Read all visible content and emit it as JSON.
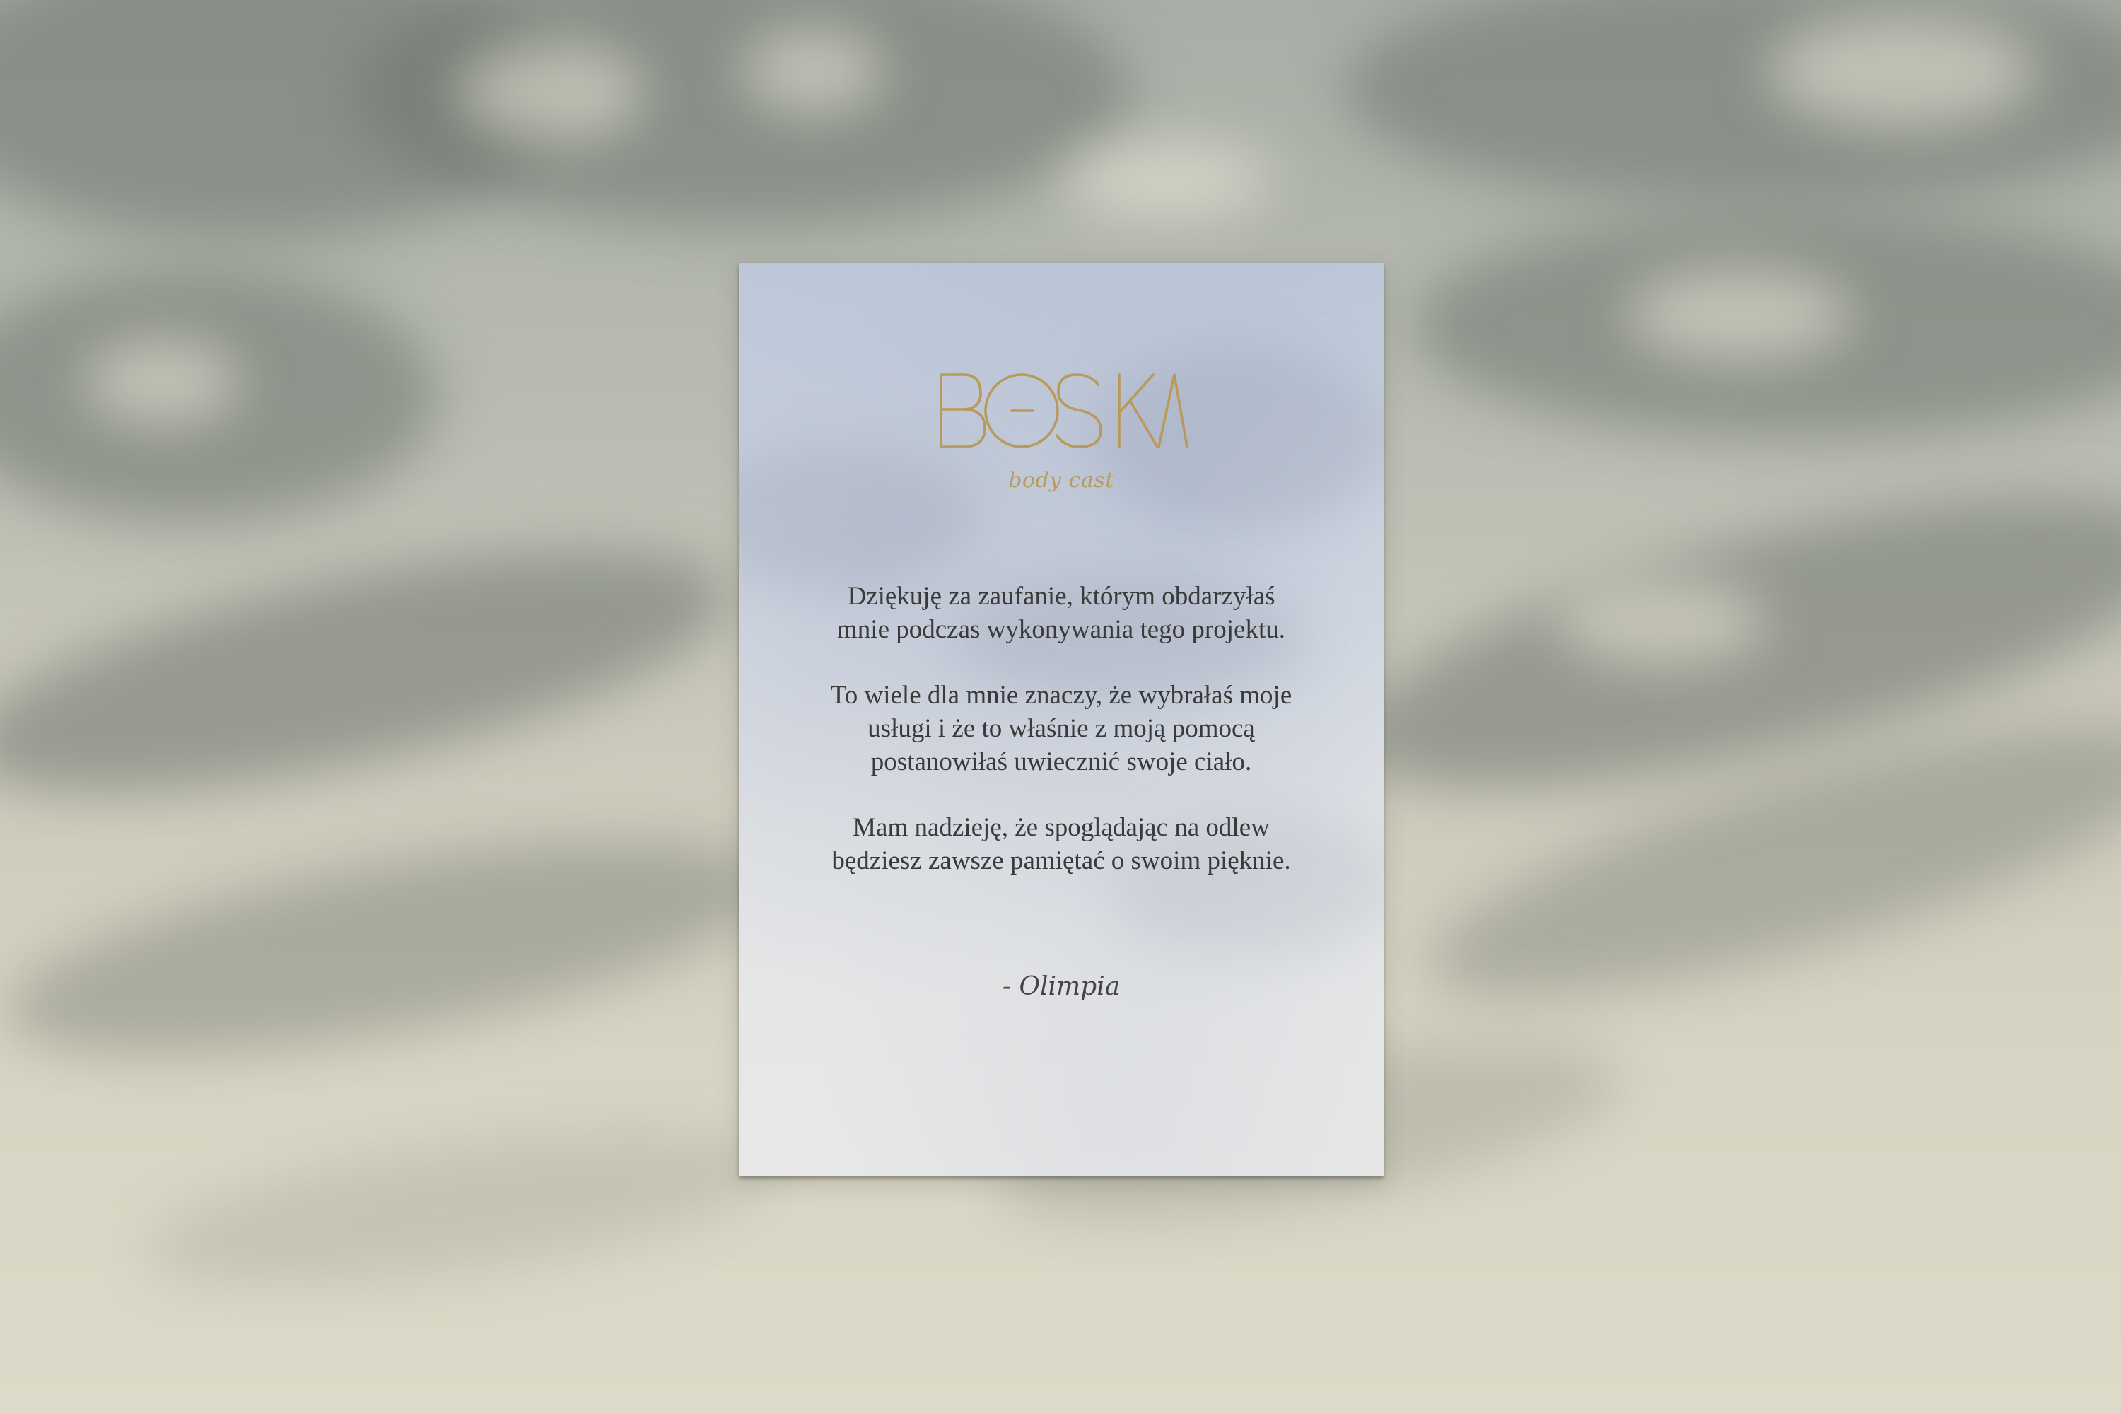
{
  "brand": {
    "name": "BOSKA",
    "tagline": "body cast",
    "color": "#b99a5c"
  },
  "message": {
    "paragraph1": {
      "line1": "Dziękuję za zaufanie, którym obdarzyłaś",
      "line2": "mnie podczas wykonywania tego projektu."
    },
    "paragraph2": {
      "line1": "To wiele dla mnie znaczy, że wybrałaś moje",
      "line2": "usługi i że to właśnie z moją pomocą",
      "line3": "postanowiłaś uwiecznić swoje ciało."
    },
    "paragraph3": {
      "line1": "Mam nadzieję, że spoglądając na odlew",
      "line2": "będziesz zawsze pamiętać o swoim pięknie."
    }
  },
  "signature": {
    "text": "- Olimpia"
  }
}
